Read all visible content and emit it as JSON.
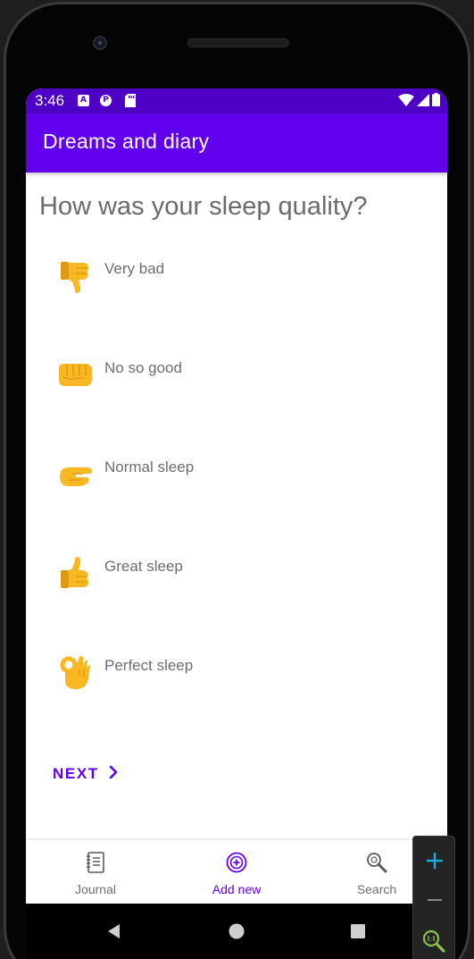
{
  "status_bar": {
    "time": "3:46",
    "notification_icons": [
      "A",
      "P",
      ""
    ]
  },
  "app_bar": {
    "title": "Dreams and diary"
  },
  "question": "How was your sleep quality?",
  "options": [
    {
      "label": "Very bad",
      "icon": "thumbs-down-emoji"
    },
    {
      "label": "No so good",
      "icon": "fist-emoji"
    },
    {
      "label": "Normal sleep",
      "icon": "pinching-hand-emoji"
    },
    {
      "label": "Great sleep",
      "icon": "thumbs-up-emoji"
    },
    {
      "label": "Perfect sleep",
      "icon": "ok-hand-emoji"
    }
  ],
  "next_button": {
    "label": "NEXT"
  },
  "bottom_nav": {
    "items": [
      {
        "label": "Journal",
        "icon": "notebook-icon",
        "active": false
      },
      {
        "label": "Add new",
        "icon": "add-circle-icon",
        "active": true
      },
      {
        "label": "Search",
        "icon": "search-icon",
        "active": false
      }
    ]
  },
  "colors": {
    "status_bar": "#4f00c7",
    "app_bar": "#6200ee",
    "accent": "#6200ee",
    "emoji_yellow": "#f8b824",
    "zoom_plus": "#19a8e0",
    "zoom_fit": "#8bc34a"
  }
}
